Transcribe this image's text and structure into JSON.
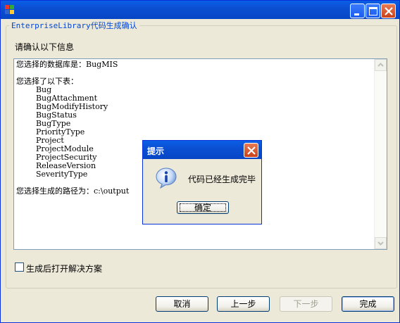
{
  "window": {
    "title": "",
    "group_title": "EnterpriseLibrary代码生成确认",
    "prompt": "请确认以下信息"
  },
  "info": {
    "lines": [
      "您选择的数据库是：BugMIS",
      "",
      "您选择了以下表：",
      "        Bug",
      "        BugAttachment",
      "        BugModifyHistory",
      "        BugStatus",
      "        BugType",
      "        PriorityType",
      "        Project",
      "        ProjectModule",
      "        ProjectSecurity",
      "        ReleaseVersion",
      "        SeverityType",
      "",
      "您选择生成的路径为：c:\\output"
    ]
  },
  "options": {
    "open_solution_label": "生成后打开解决方案",
    "open_solution_checked": false
  },
  "buttons": {
    "cancel": "取消",
    "prev": "上一步",
    "next": "下一步",
    "finish": "完成"
  },
  "dialog": {
    "title": "提示",
    "message": "代码已经生成完毕",
    "ok": "确定",
    "icon": "info-icon"
  },
  "colors": {
    "titlebar": "#0a5fe6",
    "group_title": "#0046d5",
    "window_bg": "#ece9d8"
  }
}
